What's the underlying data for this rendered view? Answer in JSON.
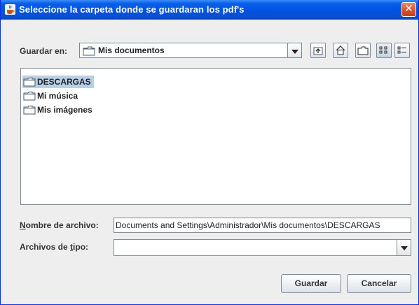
{
  "window": {
    "title": "Seleccione la carpeta donde se guardaran los pdf's",
    "close_symbol": "✕"
  },
  "toolbar": {
    "save_in_label": "Guardar en:",
    "save_in_value": "Mis documentos",
    "icons": [
      "up-folder-icon",
      "home-icon",
      "new-folder-icon",
      "list-view-icon",
      "details-view-icon"
    ]
  },
  "file_list": {
    "items": [
      {
        "label": "DESCARGAS",
        "selected": true
      },
      {
        "label": "Mi música",
        "selected": false
      },
      {
        "label": "Mis imágenes",
        "selected": false
      }
    ]
  },
  "form": {
    "filename_label_first": "N",
    "filename_label_rest": "ombre de archivo:",
    "filename_value": "Documents and Settings\\Administrador\\Mis documentos\\DESCARGAS",
    "filetype_label_pre": "Archivos de ",
    "filetype_label_key": "t",
    "filetype_label_post": "ipo:",
    "filetype_value": ""
  },
  "buttons": {
    "save": "Guardar",
    "cancel": "Cancelar"
  },
  "colors": {
    "titlebar": "#0054e3",
    "selection": "#b8cfe5",
    "close_button": "#d84f22"
  }
}
